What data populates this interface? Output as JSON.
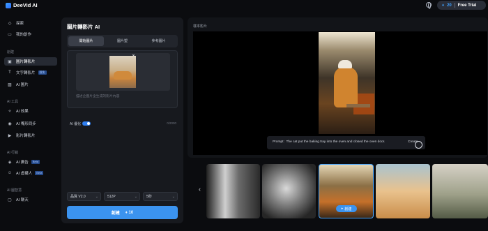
{
  "app": {
    "name": "DeeVid AI",
    "credits": "20",
    "trial_label": "Free Trial"
  },
  "sidebar": {
    "top_items": [
      {
        "label": "探索",
        "icon": "compass-icon"
      },
      {
        "label": "我的創作",
        "icon": "folder-icon"
      }
    ],
    "sections": [
      {
        "label": "創建",
        "items": [
          {
            "label": "圖片轉影片",
            "icon": "image-video-icon",
            "active": true
          },
          {
            "label": "文字轉影片",
            "icon": "text-icon",
            "badge": "限免"
          },
          {
            "label": "AI 圖片",
            "icon": "image-icon"
          }
        ]
      },
      {
        "label": "AI 工具",
        "items": [
          {
            "label": "AI 效果",
            "icon": "sparkle-icon"
          },
          {
            "label": "AI 嘴形同步",
            "icon": "lips-icon"
          },
          {
            "label": "影片轉影片",
            "icon": "video-icon"
          }
        ]
      },
      {
        "label": "AI 行銷",
        "items": [
          {
            "label": "AI 廣告",
            "icon": "megaphone-icon",
            "badge": "Beta"
          },
          {
            "label": "AI 虛擬人",
            "icon": "avatar-icon",
            "badge": "Beta"
          }
        ]
      },
      {
        "label": "AI 圖智慧",
        "items": [
          {
            "label": "AI 聊天",
            "icon": "chat-icon"
          }
        ]
      }
    ]
  },
  "panel": {
    "title": "圖片轉影片 AI",
    "tabs": [
      "開始圖片",
      "圖片塑",
      "參考圖片"
    ],
    "prompt_placeholder": "描述企圖片全生成的影片內容",
    "ai_toggle_label": "AI 優化",
    "char_count": "0/2000",
    "selects": [
      "品質 V2.0",
      "512P",
      "5秒"
    ],
    "generate_label": "創建",
    "generate_cost": "♦ 10"
  },
  "preview": {
    "label": "樣本影片",
    "prompt_prefix": "Prompt:",
    "prompt_text": "The cat put the baking tray into the oven and closed the oven door.",
    "create_label": "Create"
  },
  "gallery": {
    "selected_button": "創建"
  }
}
